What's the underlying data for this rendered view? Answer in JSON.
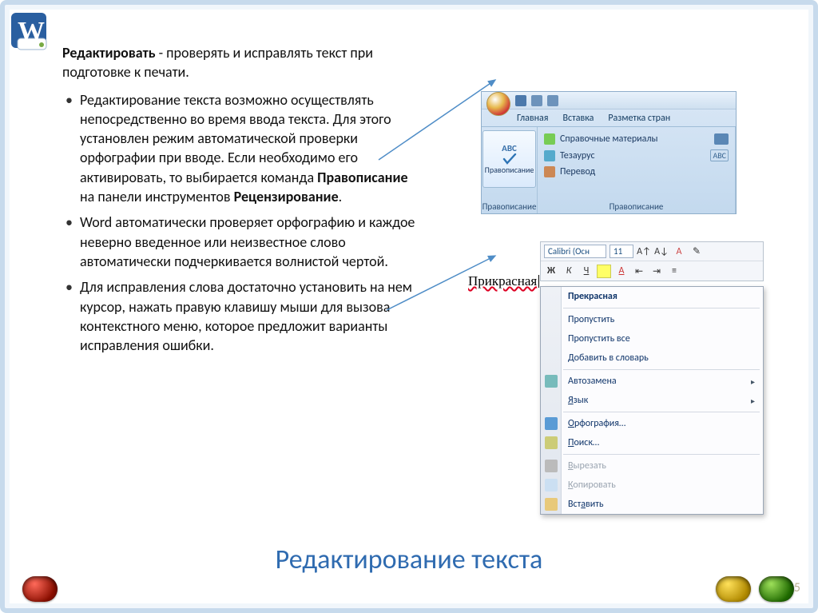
{
  "slide": {
    "title": "Редактирование текста",
    "page_number": "35",
    "lead_bold": "Редактировать",
    "lead_rest": " - проверять и исправлять текст при подготовке к печати.",
    "bullet1_a": "Редактирование текста возможно  осуществлять непосредственно во время ввода текста. Для этого установлен режим автоматической проверки орфографии при вводе. Если необходимо его активировать, то выбирается команда ",
    "bullet1_b1": "Правописание",
    "bullet1_c": " на панели инструментов ",
    "bullet1_b2": "Рецензирование",
    "bullet1_d": ".",
    "bullet2": "Word автоматически проверяет орфографию и каждое неверно введенное или неизвестное слово автоматически подчеркивается волнистой чертой.",
    "bullet3": "Для исправления слова достаточно установить на нем курсор, нажать правую клавишу мыши для вызова контекстного меню, которое предложит варианты исправления ошибки."
  },
  "ribbon": {
    "tabs": {
      "t1": "Главная",
      "t2": "Вставка",
      "t3": "Разметка стран"
    },
    "group_label": "Правописание",
    "spell_abc": "ABC",
    "spell_label": "Правописание",
    "items": {
      "i1": "Справочные материалы",
      "i2": "Тезаурус",
      "i3": "Перевод"
    },
    "small_abc": "ABC"
  },
  "mini_toolbar": {
    "font_name": "Calibri (Осн",
    "font_size": "11",
    "btn_bold": "Ж",
    "btn_italic": "К",
    "btn_strike": "Ч"
  },
  "misspelled_word": "Прикрасная",
  "context_menu": {
    "suggestion": "Прекрасная",
    "skip": "Пропустить",
    "skip_all": "Пропустить все",
    "add_dict_u": "Д",
    "add_dict_rest": "обавить в словарь",
    "autocorrect": "Автозамена",
    "language_u": "Я",
    "language_rest": "зык",
    "spelling_u": "О",
    "spelling_rest": "рфография…",
    "lookup_u": "П",
    "lookup_rest": "оиск…",
    "cut_u": "В",
    "cut_rest": "ырезать",
    "copy_u": "К",
    "copy_rest": "опировать",
    "paste": "Вст",
    "paste_u": "а",
    "paste_rest": "вить"
  }
}
